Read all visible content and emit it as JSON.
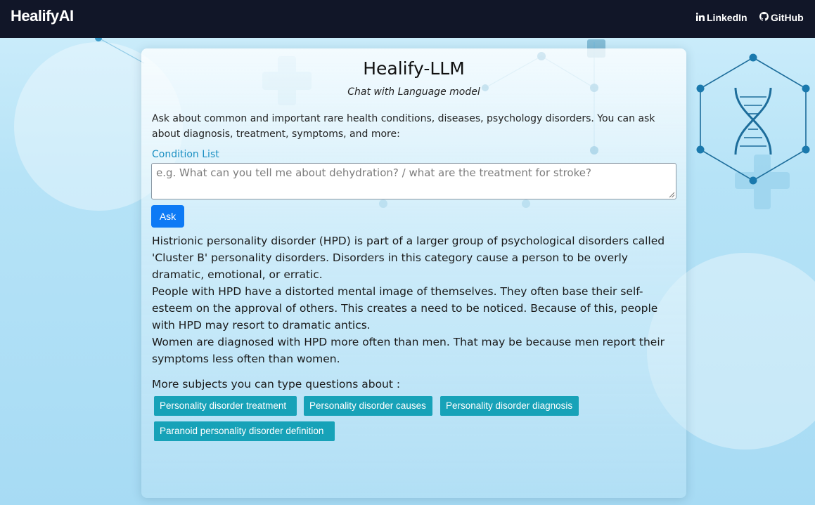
{
  "navbar": {
    "brand": "HealifyAI",
    "links": [
      {
        "label": "LinkedIn",
        "icon": "linkedin-icon"
      },
      {
        "label": "GitHub",
        "icon": "github-icon"
      }
    ],
    "background_color": "#111628"
  },
  "main": {
    "title": "Healify-LLM",
    "subtitle": "Chat with Language model",
    "intro": "Ask about common and important rare health conditions, diseases, psychology disorders. You can ask about diagnosis, treatment, symptoms, and more:",
    "field_label": "Condition List",
    "input_placeholder": "e.g. What can you tell me about dehydration? / what are the treatment for stroke?",
    "input_value": "",
    "ask_label": "Ask",
    "answer_paragraphs": [
      "Histrionic personality disorder (HPD) is part of a larger group of psychological disorders called 'Cluster B' personality disorders. Disorders in this category cause a person to be overly dramatic, emotional, or erratic.",
      "People with HPD have a distorted mental image of themselves. They often base their self-esteem on the approval of others. This creates a need to be noticed. Because of this, people with HPD may resort to dramatic antics.",
      "Women are diagnosed with HPD more often than men. That may be because men report their symptoms less often than women."
    ],
    "more_label": "More subjects you can type questions about :",
    "suggestions": [
      "Personality disorder treatment",
      "Personality disorder causes",
      "Personality disorder diagnosis",
      "Paranoid personality disorder definition"
    ]
  },
  "colors": {
    "accent": "#0d7af5",
    "chip": "#17a2b8",
    "label": "#1a8fc2",
    "decor": "#1a6fa0"
  }
}
